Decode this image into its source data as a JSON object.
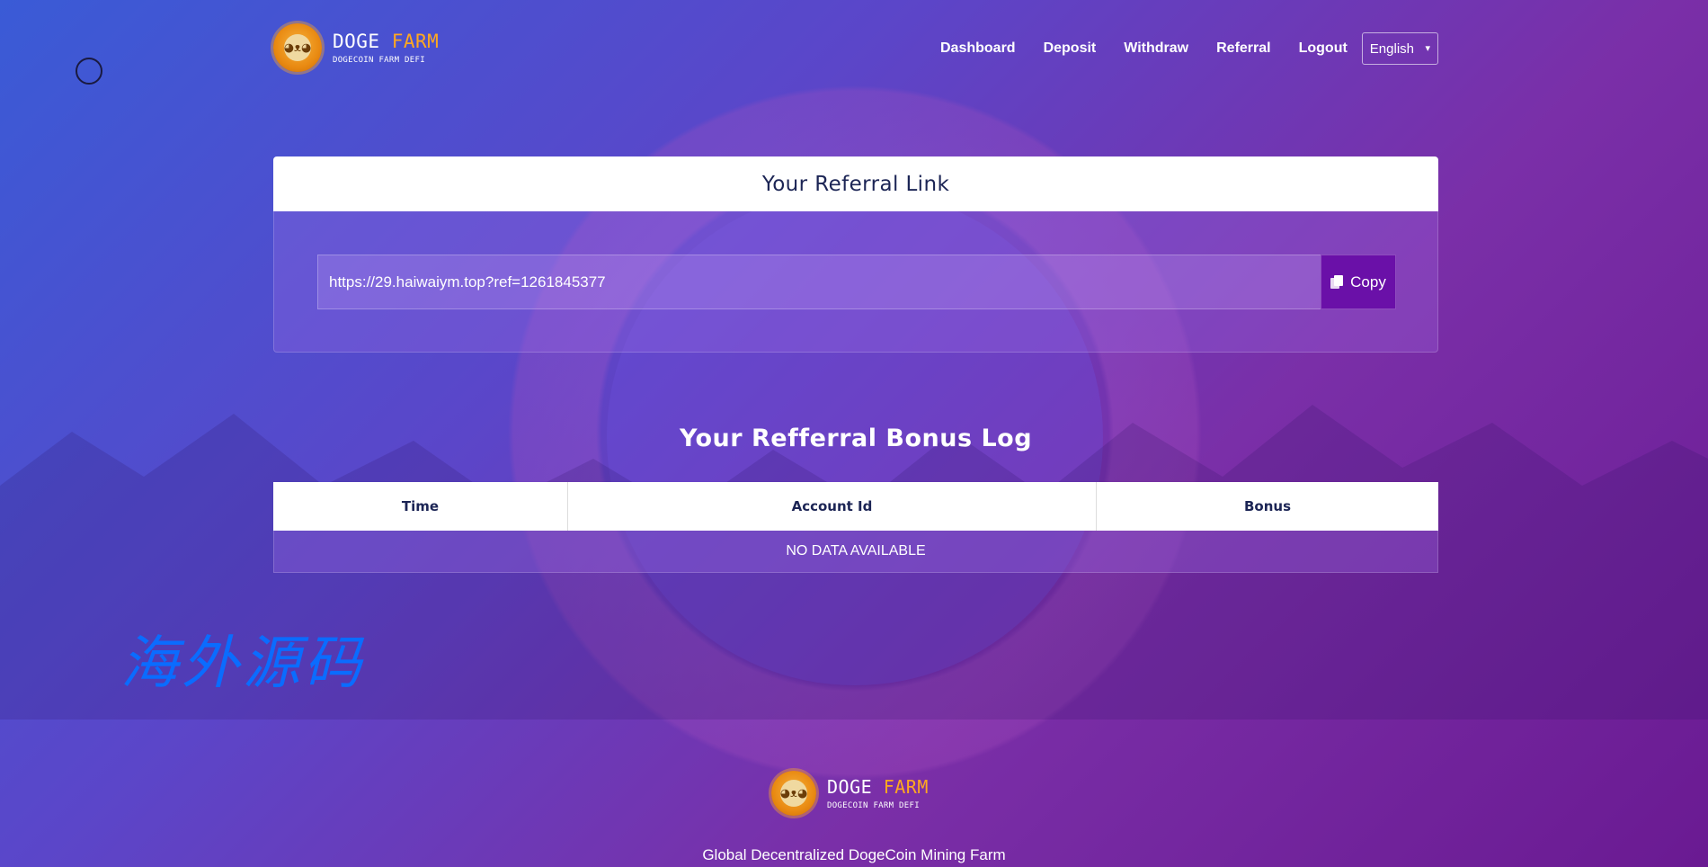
{
  "brand": {
    "name_part1": "DOGE",
    "name_part2": "FARM",
    "subtitle": "DOGECOIN FARM DEFI",
    "accent_color": "#ffa820"
  },
  "nav": {
    "items": [
      {
        "label": "Dashboard"
      },
      {
        "label": "Deposit"
      },
      {
        "label": "Withdraw"
      },
      {
        "label": "Referral"
      },
      {
        "label": "Logout"
      }
    ],
    "language": "English"
  },
  "referral": {
    "title": "Your Referral Link",
    "link": "https://29.haiwaiym.top?ref=1261845377",
    "copy_label": "Copy"
  },
  "bonus_log": {
    "title": "Your Refferral Bonus Log",
    "columns": [
      "Time",
      "Account Id",
      "Bonus"
    ],
    "empty_text": "NO DATA AVAILABLE"
  },
  "watermark": "海外源码",
  "footer": {
    "tagline": "Global Decentralized DogeCoin Mining Farm"
  },
  "colors": {
    "copy_button": "#6a10a8",
    "heading_text": "#1c2555"
  }
}
